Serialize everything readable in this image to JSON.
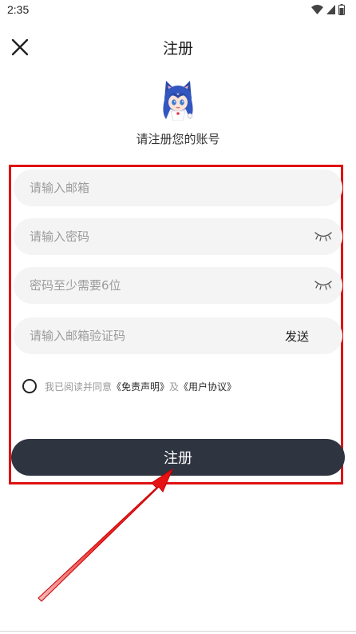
{
  "status_bar": {
    "time": "2:35",
    "icons": [
      "wifi-icon",
      "signal-icon",
      "battery-icon"
    ]
  },
  "header": {
    "title": "注册",
    "close_icon": "close-icon"
  },
  "subtitle": "请注册您的账号",
  "form": {
    "email_placeholder": "请输入邮箱",
    "password_placeholder": "请输入密码",
    "confirm_placeholder": "密码至少需要6位",
    "code_placeholder": "请输入邮箱验证码",
    "send_label": "发送"
  },
  "agreement": {
    "prefix": "我已阅读并同意",
    "disclaimer": "《免责声明》",
    "joiner": "及",
    "user_agreement": "《用户协议》"
  },
  "submit_label": "注册",
  "colors": {
    "highlight": "#e01212",
    "button": "#2f3441",
    "field_bg": "#f4f4f4"
  }
}
